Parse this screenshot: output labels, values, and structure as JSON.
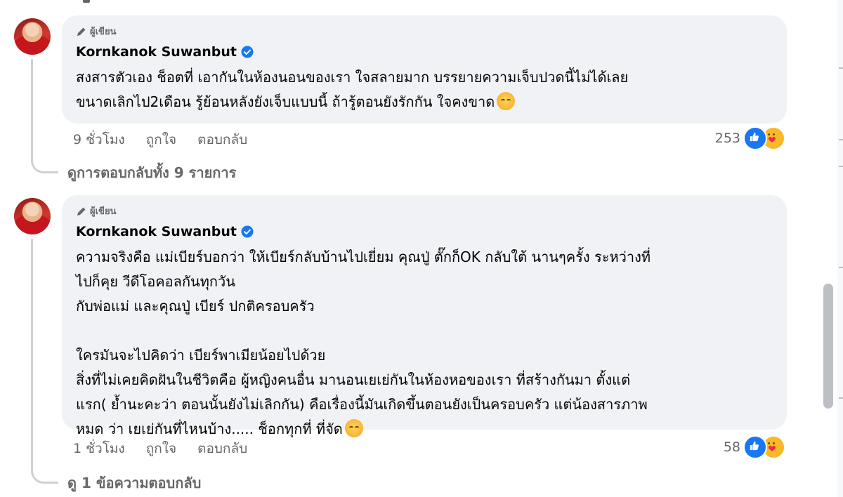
{
  "comments": [
    {
      "author_badge": "ผู้เขียน",
      "author_name": "Kornkanok Suwanbut",
      "lines": [
        "สงสารตัวเอง ช็อตที่ เอากันในห้องนอนของเรา ใจสลายมาก บรรยายความเจ็บปวดนี้ไม่ได้เลย",
        "ขนาดเลิกไป2เดือน รู้ย้อนหลังยังเจ็บแบบนี้ ถ้ารู้ตอนยังรักกัน ใจคงขาด"
      ],
      "time": "9 ชั่วโมง",
      "like_label": "ถูกใจ",
      "reply_label": "ตอบกลับ",
      "reaction_count": "253",
      "view_replies": "ดูการตอบกลับทั้ง 9 รายการ"
    },
    {
      "author_badge": "ผู้เขียน",
      "author_name": "Kornkanok Suwanbut",
      "lines": [
        "ความจริงคือ แม่เบียร์บอกว่า ให้เบียร์กลับบ้านไปเยี่ยม คุณปู่ ตั๊กก็OK กลับใต้ นานๆครั้ง ระหว่างที่",
        "ไปก็คุย วีดีโอคอลกันทุกวัน",
        "กับพ่อแม่ และคุณปู่ เบียร์ ปกติครอบครัว",
        "",
        "ใครมันจะไปคิดว่า เบียร์พาเมียน้อยไปด้วย",
        "สิ่งที่ไม่เคยคิดฝันในชีวิตคือ ผู้หญิงคนอื่น มานอนเยเย่กันในห้องหอของเรา ที่สร้างกันมา ตั้งแต่",
        "แรก( ย้ำนะคะว่า ตอนนั้นยังไม่เลิกกัน) คือเรื่องนี้มันเกิดขึ้นตอนยังเป็นครอบครัว แต่น้องสารภาพ",
        "หมด ว่า เยเย่กันที่ไหนบ้าง..... ช็อกทุกที่ ที่จัด"
      ],
      "time": "1 ชั่วโมง",
      "like_label": "ถูกใจ",
      "reply_label": "ตอบกลับ",
      "reaction_count": "58",
      "view_replies": "ดู 1 ข้อความตอบกลับ"
    }
  ],
  "icons": {
    "author_badge": "pen-icon",
    "verified": "verified-badge-icon",
    "reactions": [
      "like-icon",
      "care-icon"
    ],
    "end_emoji_1": "pensive-face-emoji",
    "end_emoji_2": "smiling-face-emoji"
  },
  "colors": {
    "bubble_bg": "#f0f2f5",
    "secondary_text": "#65676b",
    "like_blue": "#1877f2",
    "verified_blue": "#1877f2"
  }
}
